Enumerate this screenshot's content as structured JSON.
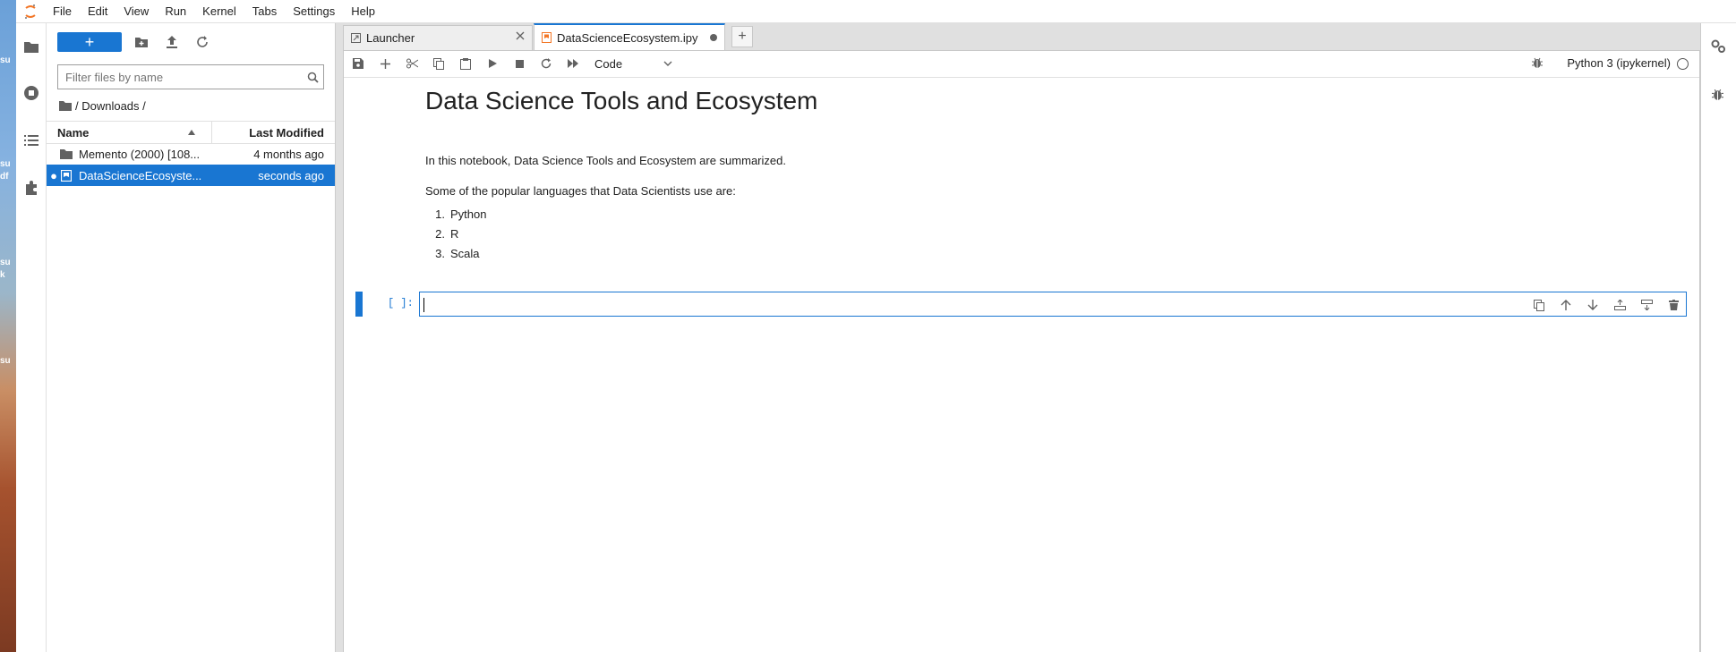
{
  "desktop": {
    "labels": [
      "su",
      "su",
      "df",
      "su",
      "k",
      "su"
    ]
  },
  "menubar": {
    "items": [
      "File",
      "Edit",
      "View",
      "Run",
      "Kernel",
      "Tabs",
      "Settings",
      "Help"
    ]
  },
  "file_browser": {
    "new_label": "+",
    "filter_placeholder": "Filter files by name",
    "breadcrumb": "/ Downloads /",
    "columns": {
      "name": "Name",
      "modified": "Last Modified"
    },
    "rows": [
      {
        "name": "Memento (2000) [108...",
        "modified": "4 months ago",
        "type": "folder",
        "selected": false,
        "running": false
      },
      {
        "name": "DataScienceEcosyste...",
        "modified": "seconds ago",
        "type": "notebook",
        "selected": true,
        "running": true
      }
    ]
  },
  "tabs": [
    {
      "label": "Launcher",
      "active": false
    },
    {
      "label": "DataScienceEcosystem.ipy",
      "active": true,
      "unsaved": true
    }
  ],
  "notebook_toolbar": {
    "cell_type": "Code",
    "kernel": "Python 3 (ipykernel)"
  },
  "notebook": {
    "title": "Data Science Tools and Ecosystem",
    "intro": "In this notebook, Data Science Tools and Ecosystem are summarized.",
    "languages_intro": "Some of the popular languages that Data Scientists use are:",
    "languages": [
      {
        "num": "1.",
        "name": "Python"
      },
      {
        "num": "2.",
        "name": "R"
      },
      {
        "num": "3.",
        "name": "Scala"
      }
    ],
    "code_prompt": "[ ]:"
  },
  "colors": {
    "accent": "#1976d2",
    "notebook_icon": "#f37626"
  }
}
